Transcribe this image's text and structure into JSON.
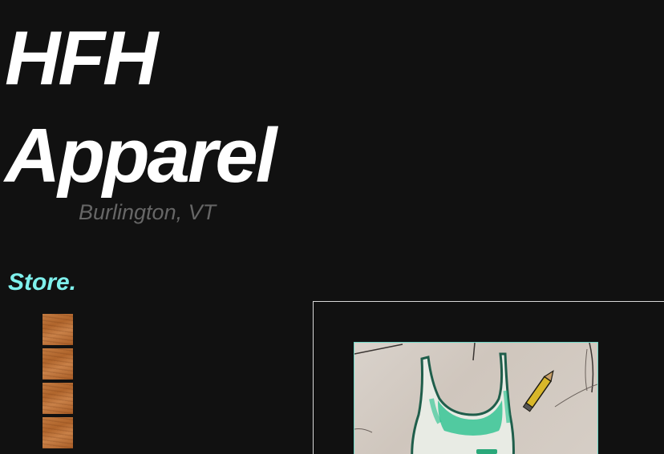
{
  "brand": {
    "line1": "HFH",
    "line2": "Apparel"
  },
  "location": "Burlington, VT",
  "nav": {
    "store_label": "Store."
  },
  "gallery": {
    "thumbnail_count": 4
  },
  "colors": {
    "background": "#111111",
    "accent": "#7ff0ec",
    "location_text": "#666666",
    "photo_border": "#6fd8c8"
  },
  "icons": {
    "photo_subject": "tank-top-sketch"
  }
}
